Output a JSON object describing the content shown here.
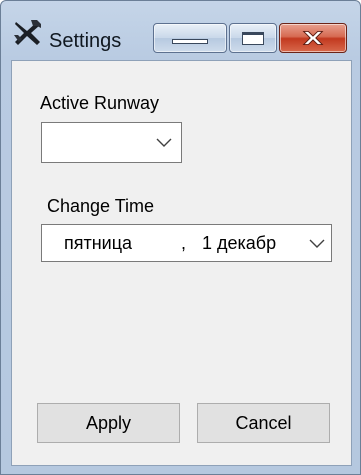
{
  "window": {
    "title": "Settings",
    "icons": {
      "app": "crossed-tools-icon",
      "minimize": "minimize-icon",
      "maximize": "maximize-icon",
      "close": "close-icon"
    }
  },
  "form": {
    "runway_label": "Active Runway",
    "runway_value": "",
    "time_label": "Change Time",
    "time_day": "пятница",
    "time_separator": ",",
    "time_date": "1 декабр"
  },
  "buttons": {
    "apply": "Apply",
    "cancel": "Cancel"
  },
  "colors": {
    "frame": "#b9cbe2",
    "client": "#f0f0f0",
    "close_button": "#c2391f",
    "button_face": "#e1e1e1"
  }
}
